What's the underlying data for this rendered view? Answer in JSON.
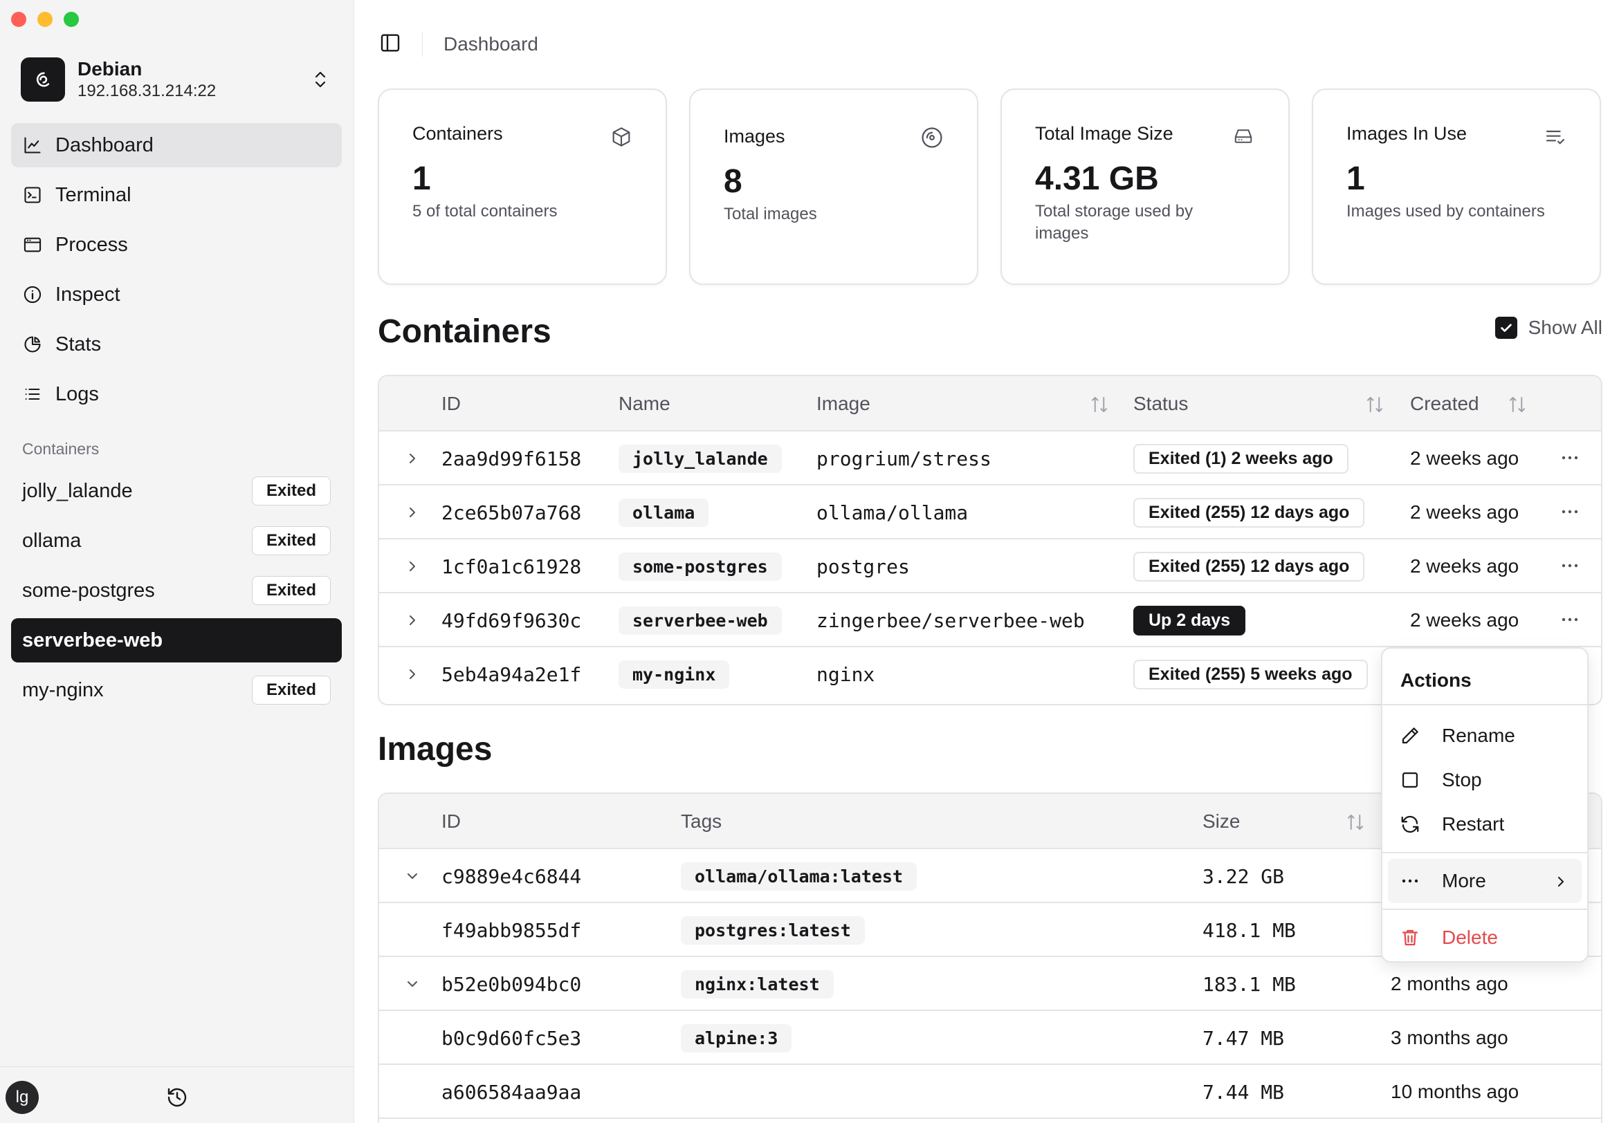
{
  "host": {
    "name": "Debian",
    "address": "192.168.31.214:22"
  },
  "nav": [
    {
      "label": "Dashboard",
      "icon": "chart-line-icon"
    },
    {
      "label": "Terminal",
      "icon": "terminal-icon"
    },
    {
      "label": "Process",
      "icon": "window-icon"
    },
    {
      "label": "Inspect",
      "icon": "info-icon"
    },
    {
      "label": "Stats",
      "icon": "pie-chart-icon"
    },
    {
      "label": "Logs",
      "icon": "list-icon"
    }
  ],
  "sidebar": {
    "containers_label": "Containers",
    "containers": [
      {
        "name": "jolly_lalande",
        "badge": "Exited"
      },
      {
        "name": "ollama",
        "badge": "Exited"
      },
      {
        "name": "some-postgres",
        "badge": "Exited"
      },
      {
        "name": "serverbee-web",
        "badge": ""
      },
      {
        "name": "my-nginx",
        "badge": "Exited"
      }
    ],
    "avatar": "lg"
  },
  "breadcrumb": "Dashboard",
  "cards": [
    {
      "title": "Containers",
      "value": "1",
      "sub": "5 of total containers"
    },
    {
      "title": "Images",
      "value": "8",
      "sub": "Total images"
    },
    {
      "title": "Total Image Size",
      "value": "4.31 GB",
      "sub": "Total storage used by images"
    },
    {
      "title": "Images In Use",
      "value": "1",
      "sub": "Images used by containers"
    }
  ],
  "containers_section": {
    "title": "Containers",
    "show_all_label": "Show All",
    "show_all_checked": true,
    "headers": {
      "id": "ID",
      "name": "Name",
      "image": "Image",
      "status": "Status",
      "created": "Created"
    },
    "rows": [
      {
        "id": "2aa9d99f6158",
        "name": "jolly_lalande",
        "image": "progrium/stress",
        "status": "Exited (1) 2 weeks ago",
        "up": false,
        "created": "2 weeks ago"
      },
      {
        "id": "2ce65b07a768",
        "name": "ollama",
        "image": "ollama/ollama",
        "status": "Exited (255) 12 days ago",
        "up": false,
        "created": "2 weeks ago"
      },
      {
        "id": "1cf0a1c61928",
        "name": "some-postgres",
        "image": "postgres",
        "status": "Exited (255) 12 days ago",
        "up": false,
        "created": "2 weeks ago"
      },
      {
        "id": "49fd69f9630c",
        "name": "serverbee-web",
        "image": "zingerbee/serverbee-web",
        "status": "Up 2 days",
        "up": true,
        "created": "2 weeks ago"
      },
      {
        "id": "5eb4a94a2e1f",
        "name": "my-nginx",
        "image": "nginx",
        "status": "Exited (255) 5 weeks ago",
        "up": false,
        "created": ""
      }
    ]
  },
  "images_section": {
    "title": "Images",
    "headers": {
      "id": "ID",
      "tags": "Tags",
      "size": "Size"
    },
    "rows": [
      {
        "id": "c9889e4c6844",
        "tag": "ollama/ollama:latest",
        "size": "3.22 GB",
        "created": "",
        "expand": true
      },
      {
        "id": "f49abb9855df",
        "tag": "postgres:latest",
        "size": "418.1 MB",
        "created": "",
        "expand": false
      },
      {
        "id": "b52e0b094bc0",
        "tag": "nginx:latest",
        "size": "183.1 MB",
        "created": "2 months ago",
        "expand": true
      },
      {
        "id": "b0c9d60fc5e3",
        "tag": "alpine:3",
        "size": "7.47 MB",
        "created": "3 months ago",
        "expand": false
      },
      {
        "id": "a606584aa9aa",
        "tag": "",
        "size": "7.44 MB",
        "created": "10 months ago",
        "expand": false
      }
    ]
  },
  "actions_menu": {
    "title": "Actions",
    "items": [
      {
        "label": "Rename",
        "icon": "pencil-icon"
      },
      {
        "label": "Stop",
        "icon": "square-icon"
      },
      {
        "label": "Restart",
        "icon": "refresh-icon"
      },
      {
        "label": "More",
        "icon": "ellipsis-icon"
      },
      {
        "label": "Delete",
        "icon": "trash-icon"
      }
    ]
  },
  "colors": {
    "accent": "#18181b",
    "danger": "#e5484d",
    "muted": "#71717a"
  }
}
